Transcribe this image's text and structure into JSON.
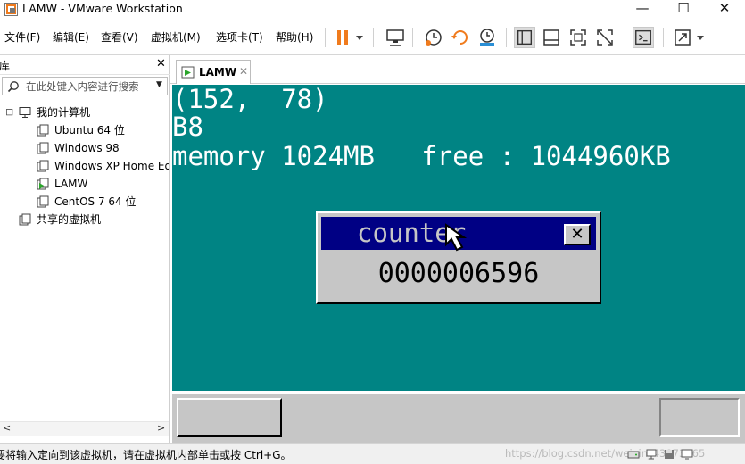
{
  "window": {
    "title": "LAMW - VMware Workstation",
    "minimize": "—",
    "maximize": "☐",
    "close": "✕"
  },
  "menu": [
    "文件(F)",
    "编辑(E)",
    "查看(V)",
    "虚拟机(M)",
    "选项卡(T)",
    "帮助(H)"
  ],
  "toolbar": {
    "icons": [
      "pause-icon",
      "dropdown-icon",
      "send-ctrl-alt-del-icon",
      "snapshot-icon",
      "revert-snapshot-icon",
      "snapshot-manager-icon",
      "show-library-icon",
      "thumbnail-bar-icon",
      "full-screen-icon",
      "unity-icon",
      "console-view-icon",
      "stretch-icon"
    ],
    "accent": "#f07b1d"
  },
  "sidebar": {
    "header": "库",
    "close": "✕",
    "search_placeholder": "在此处键入内容进行搜索",
    "tree": {
      "root": {
        "label": "我的计算机",
        "toggle": "⊟"
      },
      "vms": [
        {
          "label": "Ubuntu 64 位",
          "running": false
        },
        {
          "label": "Windows 98",
          "running": false
        },
        {
          "label": "Windows XP Home Edition",
          "running": false
        },
        {
          "label": "LAMW",
          "running": true
        },
        {
          "label": "CentOS 7 64 位",
          "running": false
        }
      ],
      "shared": {
        "label": "共享的虚拟机"
      }
    },
    "scroll_left": "<",
    "scroll_right": ">"
  },
  "tab": {
    "label": "LAMW",
    "close": "✕"
  },
  "guest": {
    "background": "#008484",
    "lines": [
      "(152,  78)",
      "B8",
      "memory 1024MB   free : 1044960KB"
    ],
    "window": {
      "title": "counter",
      "close": "✕",
      "value": "0000006596",
      "titlebar_color": "#000084"
    }
  },
  "statusbar": {
    "message": "要将输入定向到该虚拟机，请在虚拟机内部单击或按 Ctrl+G。",
    "watermark": "https://blog.csdn.net/weixin_43973265"
  }
}
